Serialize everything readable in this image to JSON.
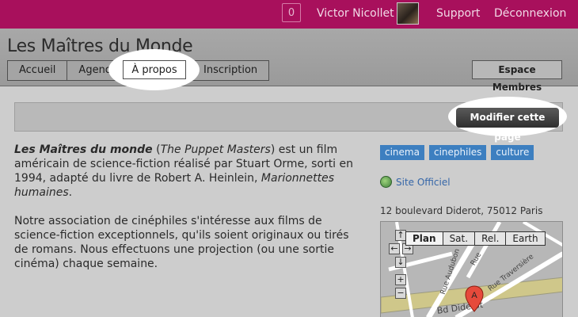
{
  "topbar": {
    "notification_count": "0",
    "user_name": "Victor Nicollet",
    "support": "Support",
    "logout": "Déconnexion"
  },
  "site": {
    "title": "Les Maîtres du Monde"
  },
  "tabs": [
    "Accueil",
    "Agenda",
    "À propos",
    "Inscription"
  ],
  "active_tab": "À propos",
  "members_button": "Espace Membres",
  "edit_button": "Modifier cette page",
  "content": {
    "p1_bold_italic": "Les Maîtres du monde",
    "p1_open_paren": " (",
    "p1_italic_title": "The Puppet Masters",
    "p1_rest": ") est un film américain de science-fiction réalisé par Stuart Orme, sorti en 1994, adapté du livre de Robert A. Heinlein, ",
    "p1_italic_book": "Marionnettes humaines",
    "p1_end": ".",
    "p2": "Notre association de cinéphiles s'intéresse aux films de science-fiction exceptionnels, qu'ils soient originaux ou tirés de romans. Nous effectuons une projection (ou une sortie cinéma) chaque semaine."
  },
  "tags": [
    "cinema",
    "cinephiles",
    "culture"
  ],
  "official_site": "Site Officiel",
  "address": "12 boulevard Diderot, 75012 Paris",
  "map": {
    "types": [
      "Plan",
      "Sat.",
      "Rel.",
      "Earth"
    ],
    "active_type": "Plan",
    "streets": [
      "Rue Audubon",
      "Rue Traversière",
      "Rue",
      "Bd Diderot"
    ],
    "marker": "A"
  },
  "colors": {
    "topbar": "#a8105c",
    "tag": "#3d7fc0",
    "link": "#3566a8"
  }
}
